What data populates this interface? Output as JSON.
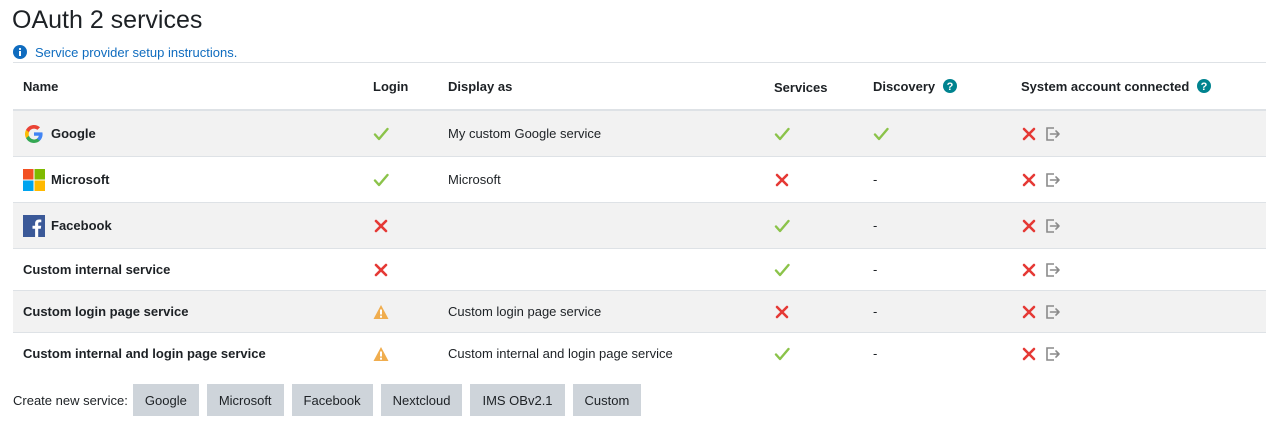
{
  "page": {
    "title": "OAuth 2 services",
    "instructions_link": "Service provider setup instructions."
  },
  "table": {
    "headers": {
      "name": "Name",
      "login": "Login",
      "display_as": "Display as",
      "services": "Services",
      "discovery": "Discovery",
      "system_account": "System account connected"
    },
    "rows": [
      {
        "name": "Google",
        "logo": "google-logo",
        "login": "yes",
        "display_as": "My custom Google service",
        "services": "yes",
        "discovery": "yes",
        "system_account": "no"
      },
      {
        "name": "Microsoft",
        "logo": "microsoft-logo",
        "login": "yes",
        "display_as": "Microsoft",
        "services": "no",
        "discovery": "-",
        "system_account": "no"
      },
      {
        "name": "Facebook",
        "logo": "facebook-logo",
        "login": "no",
        "display_as": "",
        "services": "yes",
        "discovery": "-",
        "system_account": "no"
      },
      {
        "name": "Custom internal service",
        "logo": "",
        "login": "no",
        "display_as": "",
        "services": "yes",
        "discovery": "-",
        "system_account": "no"
      },
      {
        "name": "Custom login page service",
        "logo": "",
        "login": "warning",
        "display_as": "Custom login page service",
        "services": "no",
        "discovery": "-",
        "system_account": "no"
      },
      {
        "name": "Custom internal and login page service",
        "logo": "",
        "login": "warning",
        "display_as": "Custom internal and login page service",
        "services": "yes",
        "discovery": "-",
        "system_account": "no"
      }
    ]
  },
  "create": {
    "label": "Create new service:",
    "buttons": [
      "Google",
      "Microsoft",
      "Facebook",
      "Nextcloud",
      "IMS OBv2.1",
      "Custom"
    ]
  },
  "colors": {
    "check": "#8bc34a",
    "cross": "#e53935",
    "warning": "#f0ad4e",
    "link": "#0f6cbf",
    "help": "#00838f",
    "button_bg": "#ced4da"
  }
}
